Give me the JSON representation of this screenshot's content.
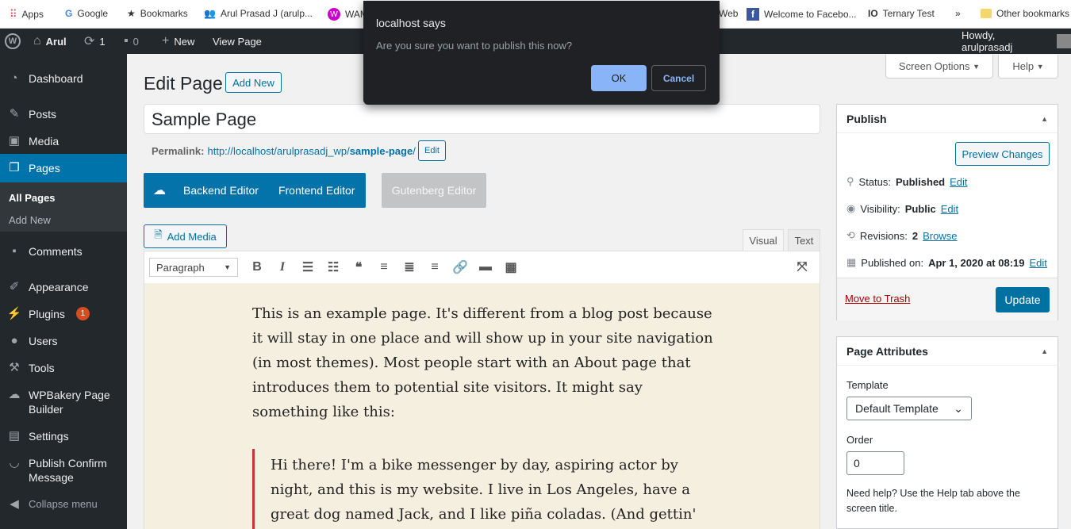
{
  "bookmarks": {
    "apps": "Apps",
    "google": "Google",
    "bookmarks": "Bookmarks",
    "arul": "Arul Prasad J (arulp...",
    "wam": "WAM",
    "web": "Web",
    "facebook": "Welcome to Facebo...",
    "ternary": "Ternary Test",
    "more": "»",
    "other": "Other bookmarks"
  },
  "adminbar": {
    "site": "Arul",
    "updates": "1",
    "comments": "0",
    "new": "New",
    "view": "View Page",
    "howdy": "Howdy, arulprasadj"
  },
  "sidebar": {
    "dashboard": "Dashboard",
    "posts": "Posts",
    "media": "Media",
    "pages": "Pages",
    "all_pages": "All Pages",
    "add_new": "Add New",
    "comments": "Comments",
    "appearance": "Appearance",
    "plugins": "Plugins",
    "plugins_badge": "1",
    "users": "Users",
    "tools": "Tools",
    "wpbakery": "WPBakery Page Builder",
    "settings": "Settings",
    "publish_confirm": "Publish Confirm Message",
    "collapse": "Collapse menu"
  },
  "header": {
    "title": "Edit Page",
    "add_new": "Add New",
    "screen_options": "Screen Options",
    "help": "Help"
  },
  "post": {
    "title": "Sample Page",
    "permalink_label": "Permalink:",
    "permalink_base": "http://localhost/arulprasadj_wp/",
    "permalink_slug": "sample-page",
    "permalink_end": "/",
    "edit": "Edit"
  },
  "builder": {
    "backend": "Backend Editor",
    "frontend": "Frontend Editor",
    "gutenberg": "Gutenberg Editor"
  },
  "editor": {
    "add_media": "Add Media",
    "tab_visual": "Visual",
    "tab_text": "Text",
    "format": "Paragraph",
    "para1": "This is an example page. It's different from a blog post because it will stay in one place and will show up in your site navigation (in most themes). Most people start with an About page that introduces them to potential site visitors. It might say something like this:",
    "quote": "Hi there! I'm a bike messenger by day, aspiring actor by night, and this is my website. I live in Los Angeles, have a great dog named Jack, and I like piña coladas. (And gettin' caught in the"
  },
  "publish": {
    "title": "Publish",
    "preview": "Preview Changes",
    "status_label": "Status:",
    "status_value": "Published",
    "visibility_label": "Visibility:",
    "visibility_value": "Public",
    "revisions_label": "Revisions:",
    "revisions_value": "2",
    "browse": "Browse",
    "published_label": "Published on:",
    "published_value": "Apr 1, 2020 at 08:19",
    "edit": "Edit",
    "trash": "Move to Trash",
    "update": "Update"
  },
  "attributes": {
    "title": "Page Attributes",
    "template_label": "Template",
    "template_value": "Default Template",
    "order_label": "Order",
    "order_value": "0",
    "help": "Need help? Use the Help tab above the screen title."
  },
  "dialog": {
    "title": "localhost says",
    "message": "Are you sure you want to publish this now?",
    "ok": "OK",
    "cancel": "Cancel"
  },
  "colors": {
    "primary": "#0073aa",
    "admin_dark": "#23282d",
    "editor_bg": "#f5efe0",
    "dialog_bg": "#202124"
  }
}
